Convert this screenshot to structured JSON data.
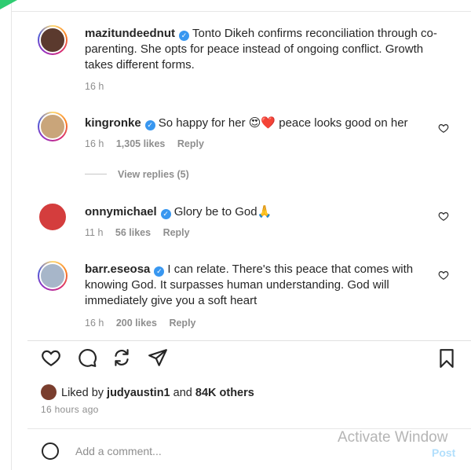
{
  "comments": [
    {
      "username": "mazitundeednut",
      "text": "Tonto Dikeh confirms reconciliation through co-parenting. She opts for peace instead of ongoing conflict. Growth takes different forms.",
      "time": "16 h",
      "likes": "",
      "reply": ""
    },
    {
      "username": "kingronke",
      "text": "So happy for her 😍❤️ peace looks good on her",
      "time": "16 h",
      "likes": "1,305 likes",
      "reply": "Reply"
    },
    {
      "username": "onnymichael",
      "text": "Glory be to God🙏",
      "time": "11 h",
      "likes": "56 likes",
      "reply": "Reply"
    },
    {
      "username": "barr.eseosa",
      "text": "I can relate. There's this peace that comes with knowing God. It surpasses human understanding. God will immediately give you a soft heart",
      "time": "16 h",
      "likes": "200 likes",
      "reply": "Reply"
    }
  ],
  "view_replies": "View replies (5)",
  "likes_summary": {
    "prefix": "Liked by",
    "user": "judyaustin1",
    "and": "and",
    "others": "84K others"
  },
  "posted_ago": "16 hours ago",
  "add_comment_placeholder": "Add a comment...",
  "post_label": "Post",
  "watermark": "Activate Window",
  "icons": {
    "like": "heart-icon",
    "comment": "comment-icon",
    "share": "share-icon",
    "send": "send-icon",
    "save": "bookmark-icon",
    "emoji": "emoji-icon"
  },
  "colors": {
    "verified": "#3897f0",
    "muted": "#8e8e8e",
    "text": "#262626",
    "post_button": "#b2dffc"
  }
}
